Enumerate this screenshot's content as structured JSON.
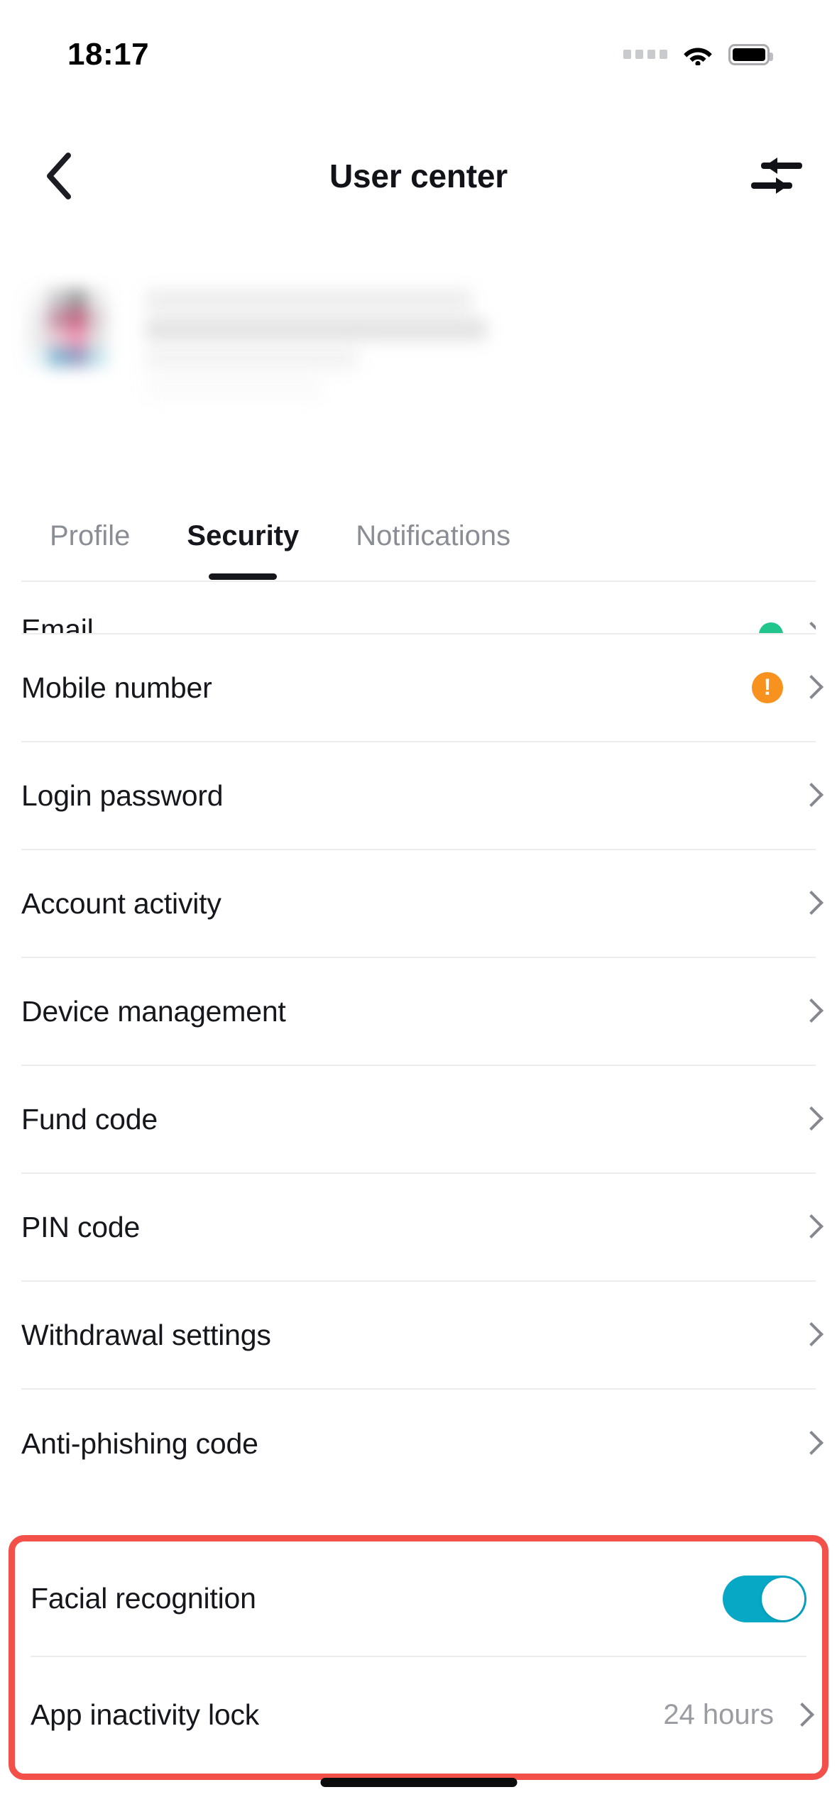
{
  "status_bar": {
    "time": "18:17",
    "signal_icon": "signal-dots-icon",
    "wifi_icon": "wifi-icon",
    "battery_icon": "battery-full-icon"
  },
  "nav": {
    "back_icon": "chevron-left-icon",
    "title": "User center",
    "action_icon": "transfer-switch-arrows-icon"
  },
  "profile": {
    "avatar": "blurred-user-avatar",
    "name_redacted": "blurred-user-name"
  },
  "tabs": [
    {
      "label": "Profile",
      "active": false
    },
    {
      "label": "Security",
      "active": true
    },
    {
      "label": "Notifications",
      "active": false
    }
  ],
  "security_list": [
    {
      "label": "Email",
      "value": "",
      "status": "verified",
      "chevron": true
    },
    {
      "label": "Mobile number",
      "value": "",
      "status": "warning",
      "chevron": true
    },
    {
      "label": "Login password",
      "value": "",
      "status": "none",
      "chevron": true
    },
    {
      "label": "Account activity",
      "value": "",
      "status": "none",
      "chevron": true
    },
    {
      "label": "Device management",
      "value": "",
      "status": "none",
      "chevron": true
    },
    {
      "label": "Fund code",
      "value": "",
      "status": "none",
      "chevron": true
    },
    {
      "label": "PIN code",
      "value": "",
      "status": "none",
      "chevron": true
    },
    {
      "label": "Withdrawal settings",
      "value": "",
      "status": "none",
      "chevron": true
    },
    {
      "label": "Anti-phishing code",
      "value": "",
      "status": "none",
      "chevron": true
    }
  ],
  "highlighted_group": {
    "facial_recognition": {
      "label": "Facial recognition",
      "toggle_state": "on"
    },
    "app_inactivity_lock": {
      "label": "App inactivity lock",
      "value": "24 hours"
    }
  },
  "colors": {
    "accent_toggle_on": "#06a8c6",
    "highlight_border": "#f4504a",
    "status_verified": "#22c58b",
    "status_warning": "#f7921e",
    "text_primary": "#15171c",
    "text_muted": "#9a9ca2"
  }
}
